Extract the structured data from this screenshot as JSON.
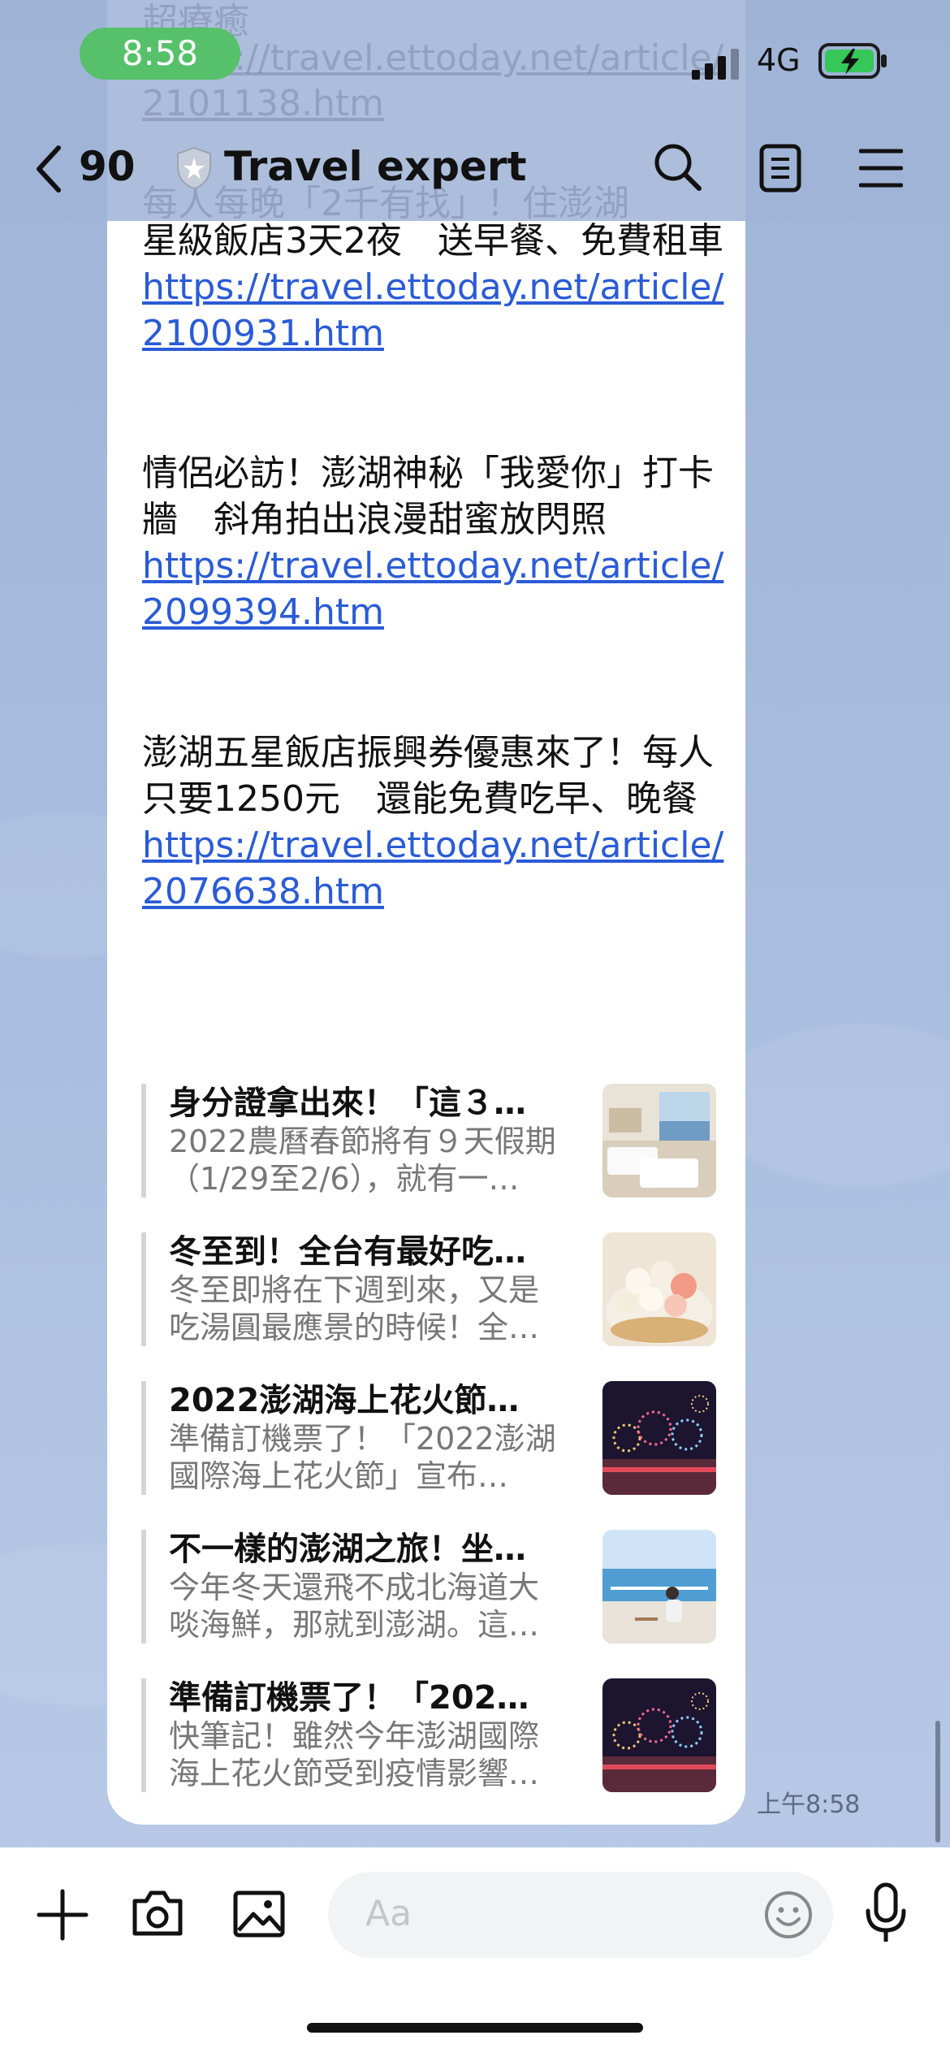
{
  "status_bar": {
    "time": "8:58",
    "network": "4G"
  },
  "header": {
    "back_count": "90",
    "title": "Travel expert",
    "ghost_line_1": "超療癒",
    "ghost_line_2": "https://travel.ettoday.net/article/",
    "ghost_line_3": "2101138.htm",
    "ghost_line_4": "每人每晚「2千有找」！住澎湖"
  },
  "message": {
    "p1_text": "星級飯店3天2夜　送早餐、免費租車",
    "p1_link_1": "https://travel.ettoday.net/article/",
    "p1_link_2": "2100931.htm",
    "p2_text": "情侶必訪！澎湖神秘「我愛你」打卡牆　斜角拍出浪漫甜蜜放閃照",
    "p2_link_1": "https://travel.ettoday.net/article/",
    "p2_link_2": "2099394.htm",
    "p3_text": "澎湖五星飯店振興券優惠來了！每人只要1250元　還能免費吃早、晚餐",
    "p3_link_1": "https://travel.ettoday.net/article/",
    "p3_link_2": "2076638.htm"
  },
  "cards": [
    {
      "title": "身分證拿出來！「這３…",
      "desc": "2022農曆春節將有９天假期（1/29至2/6），就有一…"
    },
    {
      "title": "冬至到！全台有最好吃…",
      "desc": "冬至即將在下週到來，又是吃湯圓最應景的時候！全…"
    },
    {
      "title": "2022澎湖海上花火節…",
      "desc": "準備訂機票了！「2022澎湖國際海上花火節」宣布…"
    },
    {
      "title": "不一樣的澎湖之旅！坐…",
      "desc": "今年冬天還飛不成北海道大啖海鮮，那就到澎湖。這…"
    },
    {
      "title": "準備訂機票了！「202…",
      "desc": "快筆記！雖然今年澎湖國際海上花火節受到疫情影響…"
    }
  ],
  "timestamp": "上午8:58",
  "input": {
    "placeholder": "Aa"
  },
  "icons": {
    "back": "chevron-left-icon",
    "shield": "shield-icon",
    "search": "search-icon",
    "notes": "notes-icon",
    "menu": "menu-icon",
    "add": "plus-icon",
    "camera": "camera-icon",
    "image": "image-icon",
    "emoji": "emoji-icon",
    "mic": "mic-icon"
  },
  "colors": {
    "status_green": "#56c16a",
    "link": "#2a5bd7",
    "battery_green": "#35c759"
  }
}
